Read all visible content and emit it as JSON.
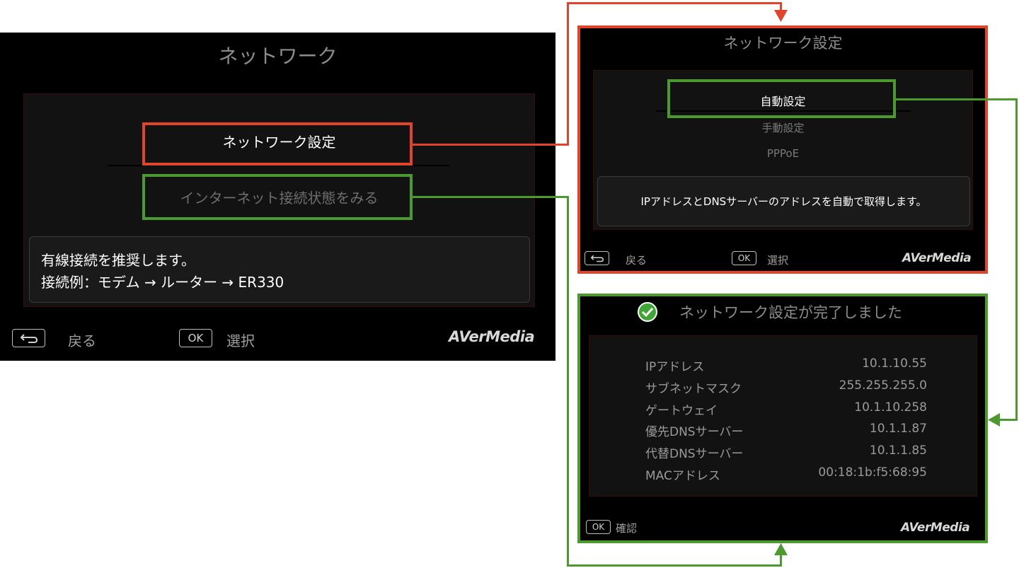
{
  "left_screen": {
    "title": "ネットワーク",
    "menu": [
      "ネットワーク設定",
      "インターネット接続状態をみる"
    ],
    "info_line1": "有線接続を推奨します。",
    "info_line2": "接続例：モデム → ルーター → ER330",
    "back_label": "戻る",
    "ok_key": "OK",
    "ok_label": "選択",
    "logo": "AVerMedia"
  },
  "settings_screen": {
    "title": "ネットワーク設定",
    "menu": [
      "自動設定",
      "手動設定",
      "PPPoE"
    ],
    "info": "IPアドレスとDNSサーバーのアドレスを自動で取得します。",
    "back_label": "戻る",
    "ok_key": "OK",
    "ok_label": "選択",
    "logo": "AVerMedia"
  },
  "done_screen": {
    "title": "ネットワーク設定が完了しました",
    "rows": [
      {
        "label": "IPアドレス",
        "value": "10.1.10.55"
      },
      {
        "label": "サブネットマスク",
        "value": "255.255.255.0"
      },
      {
        "label": "ゲートウェイ",
        "value": "10.1.10.258"
      },
      {
        "label": "優先DNSサーバー",
        "value": "10.1.1.87"
      },
      {
        "label": "代替DNSサーバー",
        "value": "10.1.1.85"
      },
      {
        "label": "MACアドレス",
        "value": "00:18:1b:f5:68:95"
      }
    ],
    "ok_key": "OK",
    "ok_label": "確認",
    "logo": "AVerMedia"
  },
  "colors": {
    "highlight_red": "#e2432b",
    "highlight_green": "#4a9a2e",
    "success_green": "#3fa535"
  },
  "icons": [
    "back-key-icon",
    "check-circle-icon",
    "arrow-head-icon"
  ]
}
